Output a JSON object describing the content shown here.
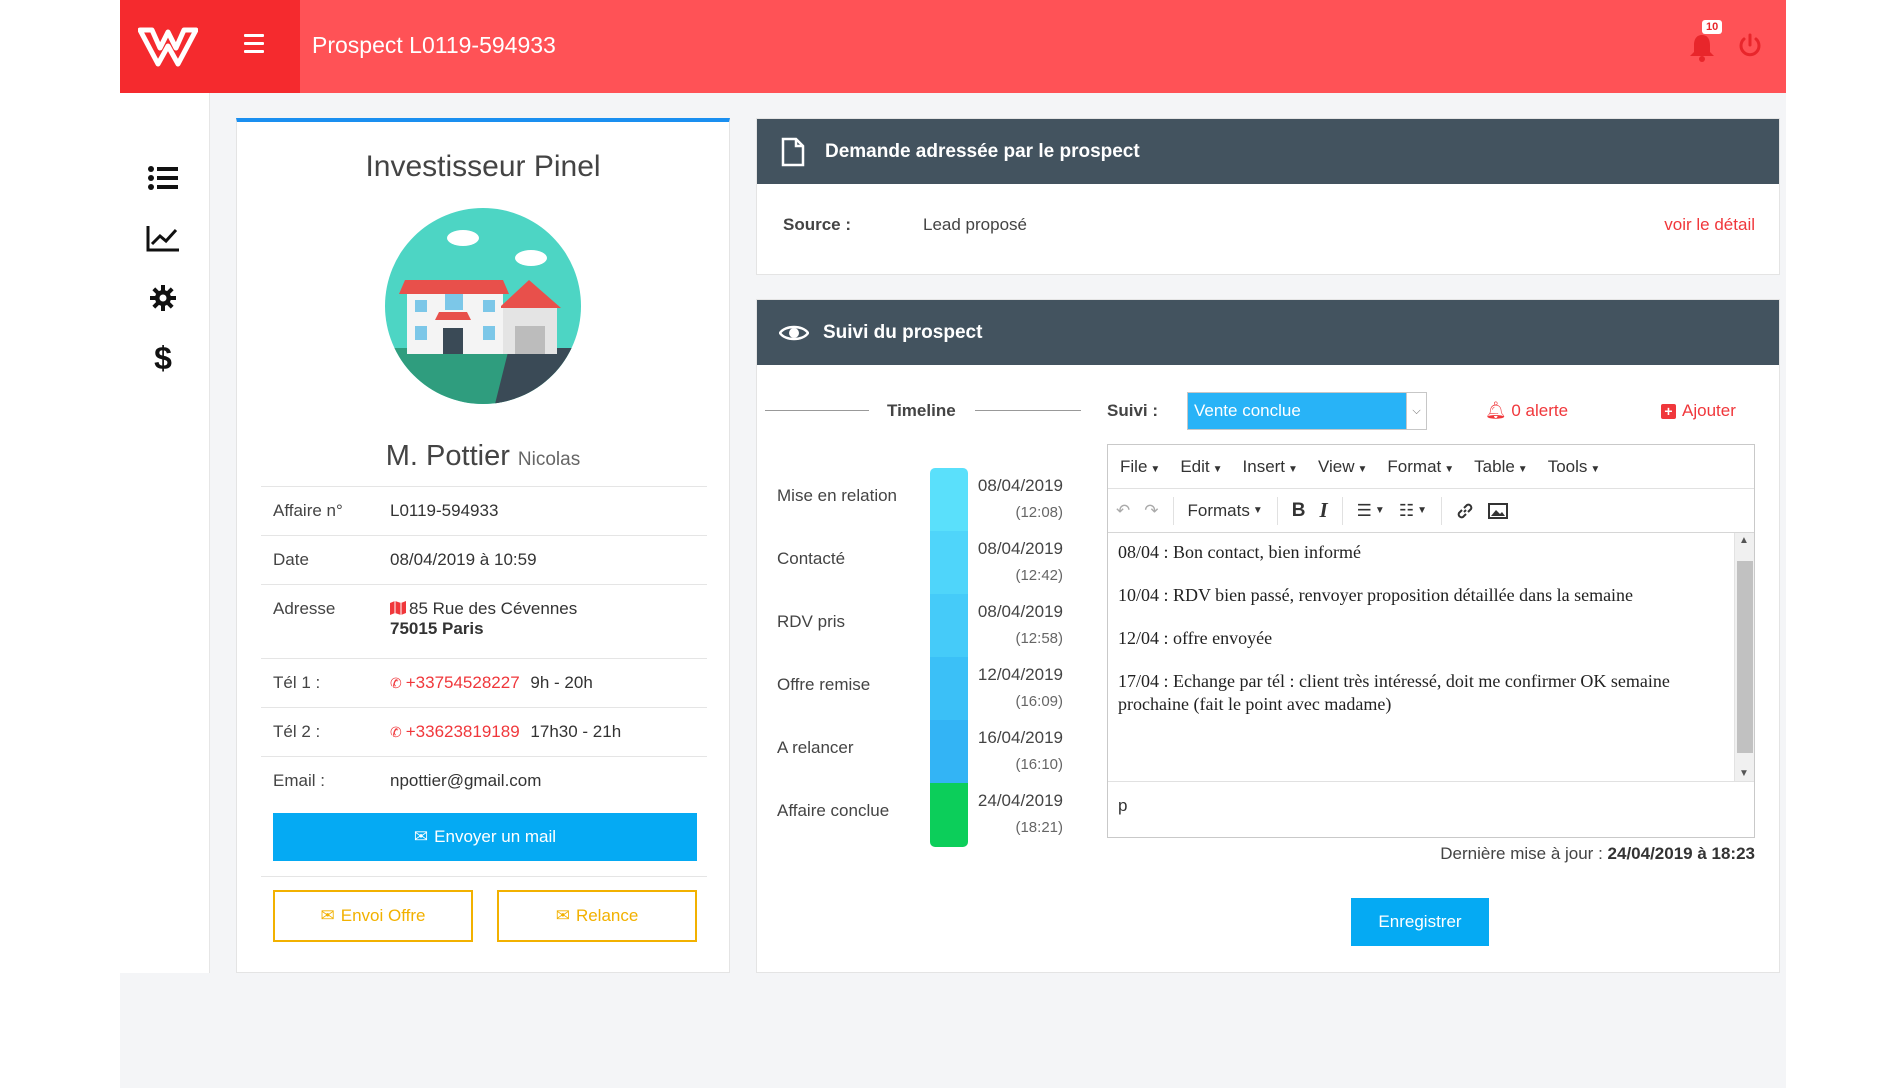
{
  "header": {
    "title": "Prospect L0119-594933",
    "notif_count": "10"
  },
  "profile": {
    "type": "Investisseur Pinel",
    "name_last": "M. Pottier",
    "name_first": "Nicolas",
    "rows": {
      "affaire_k": "Affaire n°",
      "affaire_v": "L0119-594933",
      "date_k": "Date",
      "date_v": "08/04/2019 à 10:59",
      "adresse_k": "Adresse",
      "adresse_l1": "85 Rue des Cévennes",
      "adresse_l2": "75015 Paris",
      "tel1_k": "Tél 1 :",
      "tel1_v": "+33754528227",
      "tel1_h": "9h - 20h",
      "tel2_k": "Tél 2 :",
      "tel2_v": "+33623819189",
      "tel2_h": "17h30 - 21h",
      "email_k": "Email :",
      "email_v": "npottier@gmail.com"
    },
    "btn_mail": "Envoyer un mail",
    "btn_offre": "Envoi Offre",
    "btn_relance": "Relance"
  },
  "demande": {
    "title": "Demande adressée par le prospect",
    "source_k": "Source :",
    "source_v": "Lead proposé",
    "voir": "voir le détail"
  },
  "suivi": {
    "title": "Suivi du prospect",
    "timeline_title": "Timeline",
    "timeline": [
      {
        "label": "Mise en relation",
        "date": "08/04/2019",
        "time": "(12:08)",
        "color": "#5ae0fb"
      },
      {
        "label": "Contacté",
        "date": "08/04/2019",
        "time": "(12:42)",
        "color": "#4fd5fa"
      },
      {
        "label": "RDV pris",
        "date": "08/04/2019",
        "time": "(12:58)",
        "color": "#45cbf9"
      },
      {
        "label": "Offre remise",
        "date": "12/04/2019",
        "time": "(16:09)",
        "color": "#3bc0f7"
      },
      {
        "label": "A relancer",
        "date": "16/04/2019",
        "time": "(16:10)",
        "color": "#33b4f5"
      },
      {
        "label": "Affaire conclue",
        "date": "24/04/2019",
        "time": "(18:21)",
        "color": "#0cce5a"
      }
    ],
    "suivi_label": "Suivi :",
    "status_selected": "Vente conclue",
    "alerte": "0 alerte",
    "ajouter": "Ajouter",
    "editor": {
      "menus": [
        "File",
        "Edit",
        "Insert",
        "View",
        "Format",
        "Table",
        "Tools"
      ],
      "formats": "Formats",
      "bold": "B",
      "italic": "I",
      "lines": [
        "08/04 : Bon contact, bien informé",
        "10/04 : RDV bien passé, renvoyer proposition détaillée dans la semaine",
        "12/04 : offre envoyée",
        "17/04 : Echange par tél : client très intéressé, doit me confirmer OK semaine prochaine (fait le point avec madame)"
      ],
      "status_path": "p"
    },
    "maj_label": "Dernière mise à jour :",
    "maj_value": "24/04/2019 à 18:23",
    "save": "Enregistrer"
  }
}
